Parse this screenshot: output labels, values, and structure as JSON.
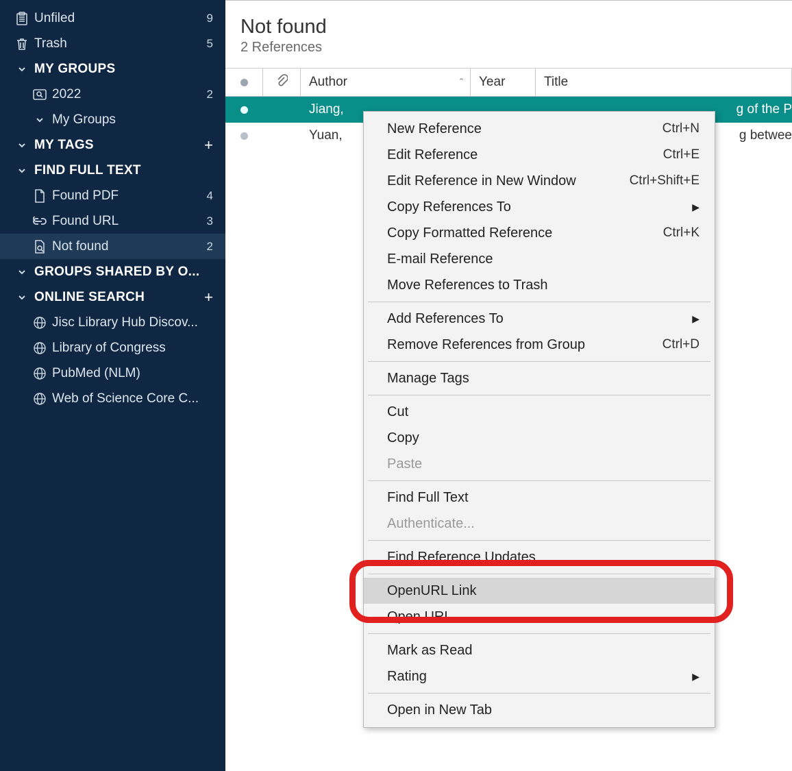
{
  "sidebar": {
    "unfiled": {
      "label": "Unfiled",
      "count": "9"
    },
    "trash": {
      "label": "Trash",
      "count": "5"
    },
    "my_groups": {
      "header": "MY GROUPS",
      "items": [
        {
          "label": "2022",
          "count": "2"
        },
        {
          "label": "My Groups"
        }
      ]
    },
    "my_tags": {
      "header": "MY TAGS"
    },
    "find_full_text": {
      "header": "FIND FULL TEXT",
      "items": [
        {
          "label": "Found PDF",
          "count": "4"
        },
        {
          "label": "Found URL",
          "count": "3"
        },
        {
          "label": "Not found",
          "count": "2"
        }
      ]
    },
    "groups_shared": {
      "header": "GROUPS SHARED BY O..."
    },
    "online_search": {
      "header": "ONLINE SEARCH",
      "items": [
        {
          "label": "Jisc Library Hub Discov..."
        },
        {
          "label": "Library of Congress"
        },
        {
          "label": "PubMed (NLM)"
        },
        {
          "label": "Web of Science Core C..."
        }
      ]
    }
  },
  "main": {
    "title": "Not found",
    "subtitle": "2 References",
    "columns": {
      "author": "Author",
      "year": "Year",
      "title": "Title"
    },
    "rows": [
      {
        "author": "Jiang,",
        "title_tail": "g of the P"
      },
      {
        "author": "Yuan,",
        "title_tail": "g betwee"
      }
    ]
  },
  "menu": {
    "new_reference": {
      "label": "New Reference",
      "shortcut": "Ctrl+N"
    },
    "edit_reference": {
      "label": "Edit Reference",
      "shortcut": "Ctrl+E"
    },
    "edit_new_window": {
      "label": "Edit Reference in New Window",
      "shortcut": "Ctrl+Shift+E"
    },
    "copy_refs_to": {
      "label": "Copy References To"
    },
    "copy_formatted": {
      "label": "Copy Formatted Reference",
      "shortcut": "Ctrl+K"
    },
    "email_ref": {
      "label": "E-mail Reference"
    },
    "move_to_trash": {
      "label": "Move References to Trash"
    },
    "add_refs_to": {
      "label": "Add References To"
    },
    "remove_from_group": {
      "label": "Remove References from Group",
      "shortcut": "Ctrl+D"
    },
    "manage_tags": {
      "label": "Manage Tags"
    },
    "cut": {
      "label": "Cut"
    },
    "copy": {
      "label": "Copy"
    },
    "paste": {
      "label": "Paste"
    },
    "find_full_text": {
      "label": "Find Full Text"
    },
    "authenticate": {
      "label": "Authenticate..."
    },
    "find_updates": {
      "label": "Find Reference Updates"
    },
    "openurl_link": {
      "label": "OpenURL Link"
    },
    "open_url": {
      "label": "Open URL"
    },
    "mark_as_read": {
      "label": "Mark as Read"
    },
    "rating": {
      "label": "Rating"
    },
    "open_new_tab": {
      "label": "Open in New Tab"
    }
  }
}
